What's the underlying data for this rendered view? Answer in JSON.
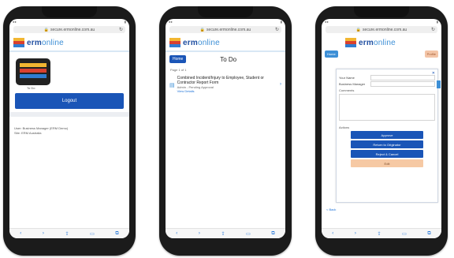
{
  "phone1": {
    "url": "secure.ermonline.com.au",
    "logo": {
      "erm": "erm",
      "online": "online"
    },
    "tile_label": "To Do",
    "logout_label": "Logout",
    "info_lines": [
      "User: Business Manager (ERM Demo)",
      "Site: ERM Australia"
    ]
  },
  "phone2": {
    "url": "secure.ermonline.com.au",
    "logo": {
      "erm": "erm",
      "online": "online"
    },
    "home_label": "Home",
    "title": "To Do",
    "page_label": "Page 1 of 1",
    "item_title": "Combined Incident/Injury to Employee, Student or Contractor Report Form",
    "item_sub": "Admin - Pending Approval",
    "item_link": "View Details"
  },
  "phone3": {
    "url": "secure.ermonline.com.au",
    "logo": {
      "erm": "erm",
      "online": "online"
    },
    "home_label": "Home",
    "user_label": "Profile",
    "form_rows": [
      {
        "k": "Your Name",
        "v": ""
      },
      {
        "k": "Business Manager",
        "v": ""
      }
    ],
    "comments_label": "Comments",
    "actions_label": "Actions",
    "buttons": [
      "Approve",
      "Return to Originator",
      "Reject & Cancel",
      "Edit"
    ],
    "back_link": "< Back"
  },
  "colors": {
    "primary": "#1a55b7",
    "accent": "#3d8fd6",
    "edit": "#f6c9a4"
  }
}
